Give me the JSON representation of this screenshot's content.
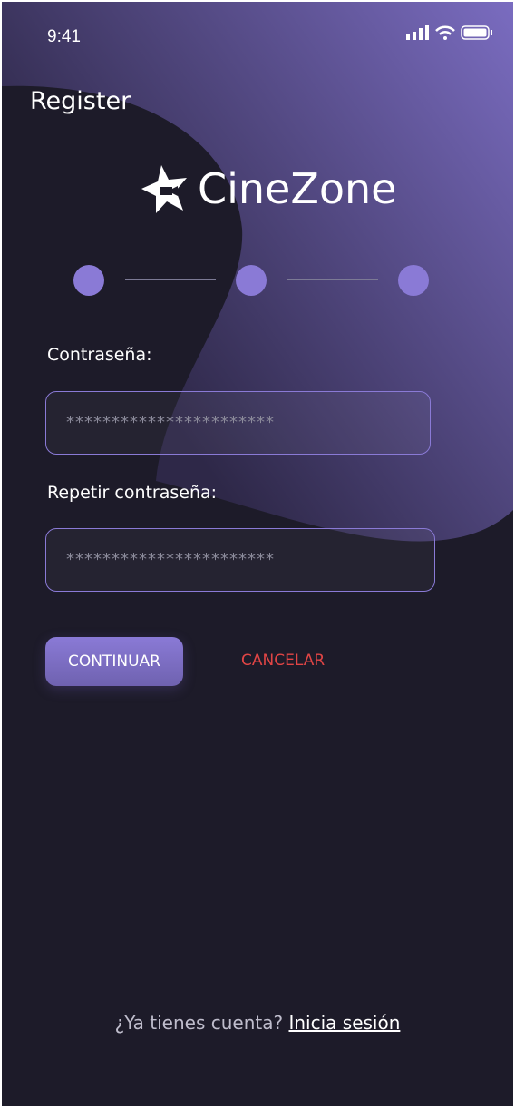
{
  "status": {
    "time": "9:41"
  },
  "header": {
    "title": "Register"
  },
  "logo": {
    "name": "CineZone"
  },
  "steps": {
    "count": 3,
    "current": 3
  },
  "form": {
    "password_label": "Contraseña:",
    "password_value": "***********************",
    "repeat_label": "Repetir contraseña:",
    "repeat_value": "***********************"
  },
  "actions": {
    "continue": "CONTINUAR",
    "cancel": "CANCELAR"
  },
  "footer": {
    "prompt": "¿Ya tienes cuenta?",
    "link": "Inicia sesión"
  },
  "colors": {
    "accent": "#8a7ad6",
    "danger": "#e04545",
    "background": "#1d1b29"
  }
}
